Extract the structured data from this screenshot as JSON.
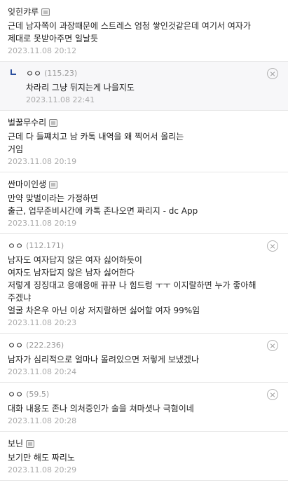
{
  "comments": [
    {
      "nick": "잊힌캬루",
      "ip": "",
      "has_badge": true,
      "reply": false,
      "deletable": false,
      "body": "근데 남자쪽이 과장때문에 스트레스 엄청 쌓인것같은데 여기서 여자가 제대로 못받아주면 일날듯",
      "date": "2023.11.08 20:12"
    },
    {
      "nick": "ㅇㅇ",
      "ip": "(115.23)",
      "has_badge": false,
      "reply": true,
      "deletable": true,
      "body": "차라리 그냥 뒤지는게 나을지도",
      "date": "2023.11.08 22:41"
    },
    {
      "nick": "벌꿀무수리",
      "ip": "",
      "has_badge": true,
      "reply": false,
      "deletable": false,
      "body": "근데 다 들쨰치고 남 카톡 내역을 왜 찍어서 올리는\n거임",
      "date": "2023.11.08 20:19"
    },
    {
      "nick": "싼마이인생",
      "ip": "",
      "has_badge": true,
      "reply": false,
      "deletable": false,
      "body": "만약 맞벌이라는 가정하면\n출근, 업무준비시간에 카톡 존나오면 짜리지 - dc App",
      "date": "2023.11.08 20:19"
    },
    {
      "nick": "ㅇㅇ",
      "ip": "(112.171)",
      "has_badge": false,
      "reply": false,
      "deletable": true,
      "body": "남자도 여자답지 않은 여자 싫어하듯이\n여자도 남자답지 않은 남자 싫어한다\n저렇게 징징대고 응애응애 뀨뀨 나 힘드렁 ㅜㅜ 이지랄하면 누가 좋아해주겠냐\n얼굴 차은우 아닌 이상 저지랄하면 싫어할 여자 99%임",
      "date": "2023.11.08 20:23"
    },
    {
      "nick": "ㅇㅇ",
      "ip": "(222.236)",
      "has_badge": false,
      "reply": false,
      "deletable": true,
      "body": "남자가 심리적으로 얼마나 몰려있으면 저렇게 보냈겠나",
      "date": "2023.11.08 20:24"
    },
    {
      "nick": "ㅇㅇ",
      "ip": "(59.5)",
      "has_badge": false,
      "reply": false,
      "deletable": true,
      "body": "대화 내용도 존나 의처증인가 술을 쳐마셧나 극혐이네",
      "date": "2023.11.08 20:28"
    },
    {
      "nick": "보닌",
      "ip": "",
      "has_badge": true,
      "reply": false,
      "deletable": false,
      "body": "보기만 해도 짜리노",
      "date": "2023.11.08 20:29"
    }
  ]
}
